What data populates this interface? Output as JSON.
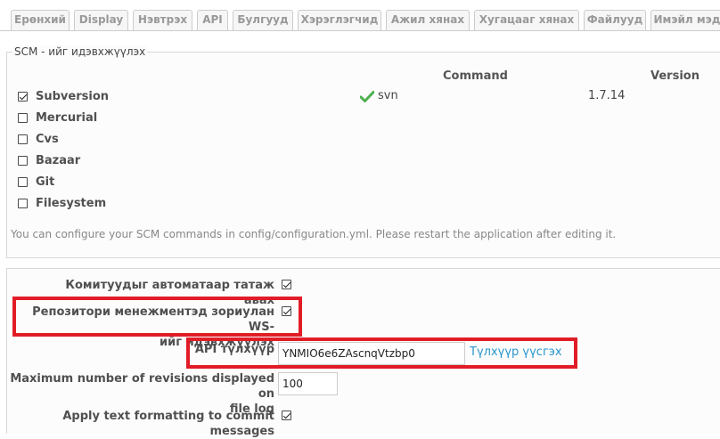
{
  "tabs": [
    "Ерөнхий",
    "Display",
    "Нэвтрэх",
    "API",
    "Булгууд",
    "Хэрэглэгчид",
    "Ажил хянах",
    "Хугацааг хянах",
    "Файлууд",
    "Имэйл мэд"
  ],
  "scm": {
    "legend": "SCM - ийг идэвхжүүлэх",
    "column_command": "Command",
    "column_version": "Version",
    "items": [
      {
        "label": "Subversion",
        "checked": true,
        "command": "svn",
        "version": "1.7.14"
      },
      {
        "label": "Mercurial",
        "checked": false
      },
      {
        "label": "Cvs",
        "checked": false
      },
      {
        "label": "Bazaar",
        "checked": false
      },
      {
        "label": "Git",
        "checked": false
      },
      {
        "label": "Filesystem",
        "checked": false
      }
    ],
    "hint": "You can configure your SCM commands in config/configuration.yml. Please restart the application after editing it.",
    "ok_icon": "checkmark-icon",
    "ok_color": "#4caf50"
  },
  "settings": {
    "autofetch_label": "Комитуудыг автоматаар татаж авах",
    "autofetch_checked": true,
    "ws_label_line1": "Репозитори менежментэд зориулан WS-",
    "ws_label_line2": "ийг идэвхжүүлэх",
    "ws_checked": true,
    "api_key_label": "API түлхүүр",
    "api_key_value": "YNMIO6e6ZAscnqVtzbp0",
    "generate_key_link": "Түлхүүр үүсгэх",
    "max_revisions_label_line1": "Maximum number of revisions displayed on",
    "max_revisions_label_line2": "file log",
    "max_revisions_value": "100",
    "text_formatting_label": "Apply text formatting to commit messages",
    "text_formatting_checked": true
  },
  "colors": {
    "highlight": "#e11c27",
    "link": "#2996cc"
  }
}
